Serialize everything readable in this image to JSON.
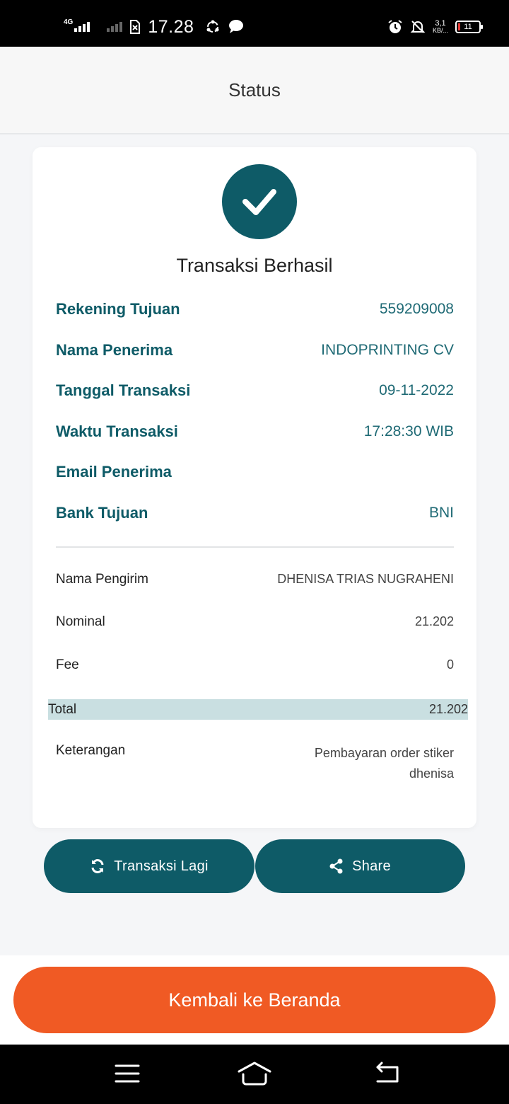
{
  "status_bar": {
    "network": "4G",
    "time": "17.28",
    "speed_value": "3,1",
    "speed_unit": "KB/...",
    "battery": "11"
  },
  "header": {
    "title": "Status"
  },
  "result": {
    "title": "Transaksi Berhasil"
  },
  "details": [
    {
      "label": "Rekening Tujuan",
      "value": "559209008"
    },
    {
      "label": "Nama Penerima",
      "value": "INDOPRINTING CV"
    },
    {
      "label": "Tanggal Transaksi",
      "value": "09-11-2022"
    },
    {
      "label": "Waktu Transaksi",
      "value": "17:28:30 WIB"
    },
    {
      "label": "Email Penerima",
      "value": ""
    },
    {
      "label": "Bank Tujuan",
      "value": "BNI"
    }
  ],
  "summary": {
    "sender_label": "Nama Pengirim",
    "sender_value": "DHENISA TRIAS NUGRAHENI",
    "nominal_label": "Nominal",
    "nominal_value": "21.202",
    "fee_label": "Fee",
    "fee_value": "0",
    "total_label": "Total",
    "total_value": "21.202",
    "note_label": "Keterangan",
    "note_value": "Pembayaran order stiker dhenisa"
  },
  "actions": {
    "again_label": "Transaksi Lagi",
    "share_label": "Share",
    "home_label": "Kembali ke Beranda"
  },
  "colors": {
    "primary": "#0e5b67",
    "accent": "#f05a24",
    "total_bg": "#c9dfe1"
  },
  "icons": [
    "check-icon",
    "refresh-icon",
    "share-icon",
    "menu-icon",
    "home-icon",
    "back-icon"
  ]
}
